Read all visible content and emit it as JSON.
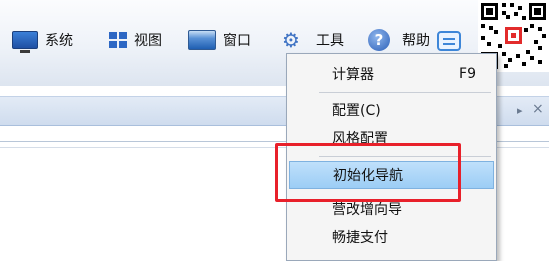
{
  "menubar": {
    "items": [
      {
        "label": "系统",
        "icon": "monitor-icon"
      },
      {
        "label": "视图",
        "icon": "view-grid-icon"
      },
      {
        "label": "窗口",
        "icon": "window-icon"
      },
      {
        "label": "工具",
        "icon": "gear-icon"
      },
      {
        "label": "帮助",
        "icon": "help-icon"
      }
    ],
    "chat_icon": "chat-icon",
    "qr_icon": "qr-code"
  },
  "panel": {
    "arrow": "▸",
    "close": "×"
  },
  "tools_menu": {
    "items": [
      {
        "label": "计算器",
        "shortcut": "F9"
      },
      {
        "label": "配置(C)",
        "shortcut": ""
      },
      {
        "label": "风格配置",
        "shortcut": ""
      },
      {
        "label": "初始化导航",
        "shortcut": "",
        "hover": true
      },
      {
        "label": "营改增向导",
        "shortcut": ""
      },
      {
        "label": "畅捷支付",
        "shortcut": ""
      }
    ]
  },
  "colors": {
    "highlight_box": "#e8202a",
    "hover_item": "#9ccdf5",
    "accent": "#2d67c4"
  }
}
